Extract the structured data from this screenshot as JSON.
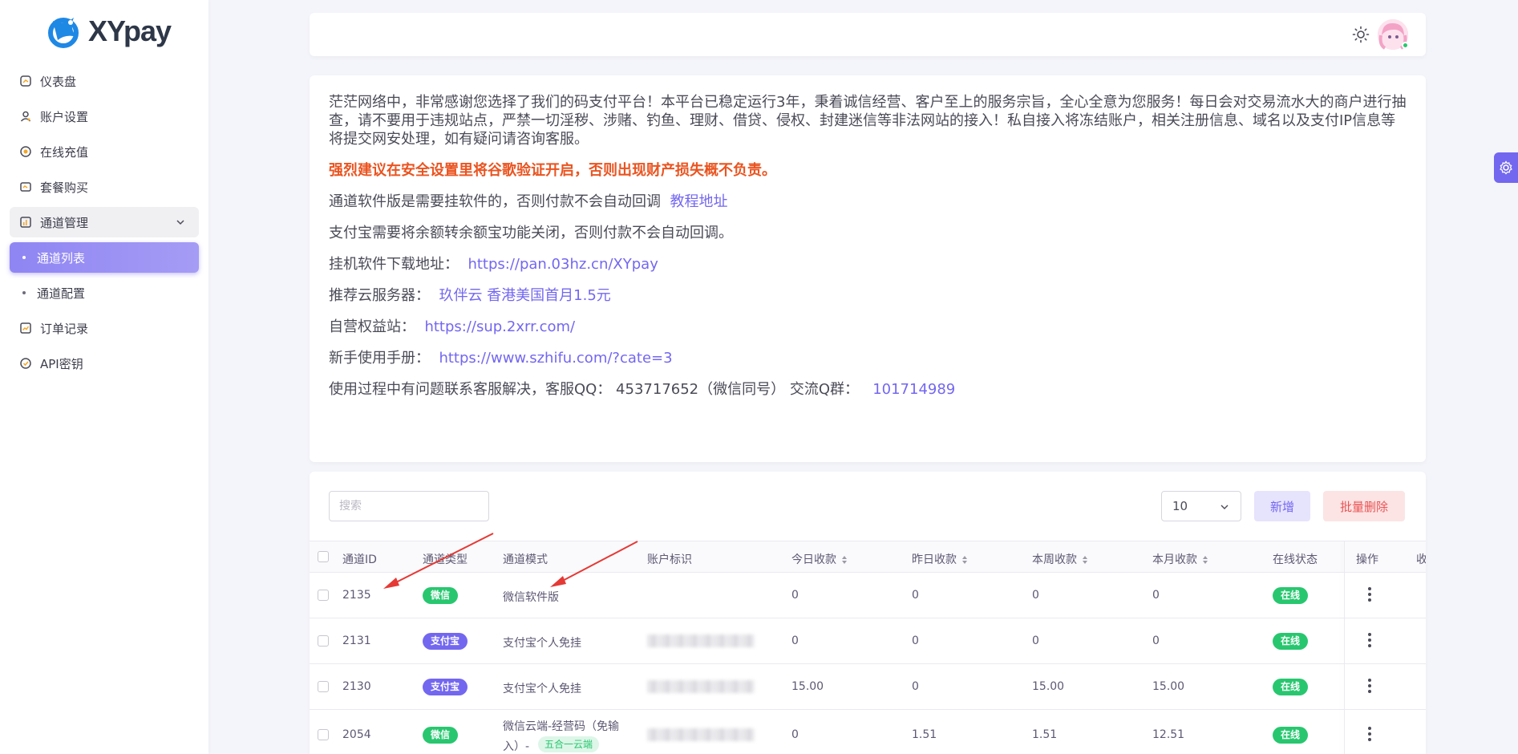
{
  "brand": {
    "name": "XYpay"
  },
  "sidebar": {
    "items": [
      {
        "label": "仪表盘",
        "icon": "dashboard-icon"
      },
      {
        "label": "账户设置",
        "icon": "user-icon"
      },
      {
        "label": "在线充值",
        "icon": "coin-icon"
      },
      {
        "label": "套餐购买",
        "icon": "package-icon"
      },
      {
        "label": "通道管理",
        "icon": "chart-icon"
      },
      {
        "label": "通道列表"
      },
      {
        "label": "通道配置"
      },
      {
        "label": "订单记录",
        "icon": "order-icon"
      },
      {
        "label": "API密钥",
        "icon": "key-icon"
      }
    ]
  },
  "notice": {
    "intro": "茫茫网络中，非常感谢您选择了我们的码支付平台！本平台已稳定运行3年，秉着诚信经营、客户至上的服务宗旨，全心全意为您服务！每日会对交易流水大的商户进行抽查，请不要用于违规站点，严禁一切淫秽、涉赌、钓鱼、理财、借贷、侵权、封建迷信等非法网站的接入！私自接入将冻结账户，相关注册信息、域名以及支付IP信息等将提交网安处理，如有疑问请咨询客服。",
    "warning": "强烈建议在安全设置里将谷歌验证开启，否则出现财产损失概不负责。",
    "software_text": "通道软件版是需要挂软件的，否则付款不会自动回调",
    "tutorial_link": "教程地址",
    "alipay_text": "支付宝需要将余额转余额宝功能关闭，否则付款不会自动回调。",
    "download_label": "挂机软件下载地址：",
    "download_link": "https://pan.03hz.cn/XYpay",
    "server_label": "推荐云服务器：",
    "server_link": "玖伴云 香港美国首月1.5元",
    "rights_label": "自营权益站：",
    "rights_link": "https://sup.2xrr.com/",
    "manual_label": "新手使用手册：",
    "manual_link": "https://www.szhifu.com/?cate=3",
    "support_text": "使用过程中有问题联系客服解决，客服QQ：  453717652（微信同号）   交流Q群：",
    "group_link": "101714989"
  },
  "toolbar": {
    "search_placeholder": "搜索",
    "page_size": "10",
    "new_label": "新增",
    "batch_delete_label": "批量删除"
  },
  "table": {
    "headers": [
      "通道ID",
      "通道类型",
      "通道模式",
      "账户标识",
      "今日收款",
      "昨日收款",
      "本周收款",
      "本月收款",
      "在线状态",
      "操作",
      "收"
    ],
    "rows": [
      {
        "id": "2135",
        "type": "微信",
        "mode": "微信软件版",
        "today": "0",
        "yesterday": "0",
        "week": "0",
        "month": "0",
        "status": "在线"
      },
      {
        "id": "2131",
        "type": "支付宝",
        "mode": "支付宝个人免挂",
        "today": "0",
        "yesterday": "0",
        "week": "0",
        "month": "0",
        "status": "在线"
      },
      {
        "id": "2130",
        "type": "支付宝",
        "mode": "支付宝个人免挂",
        "today": "15.00",
        "yesterday": "0",
        "week": "15.00",
        "month": "15.00",
        "status": "在线"
      },
      {
        "id": "2054",
        "type": "微信",
        "mode_line1": "微信云端-经营码（免输",
        "mode_line2": "入）-",
        "mode_badge": "五合一云端",
        "today": "0",
        "yesterday": "1.51",
        "week": "1.51",
        "month": "12.51",
        "status": "在线"
      }
    ]
  },
  "colors": {
    "primary": "#7367f0",
    "success": "#28c76f",
    "danger": "#ea5455",
    "warning": "#ea5420"
  }
}
